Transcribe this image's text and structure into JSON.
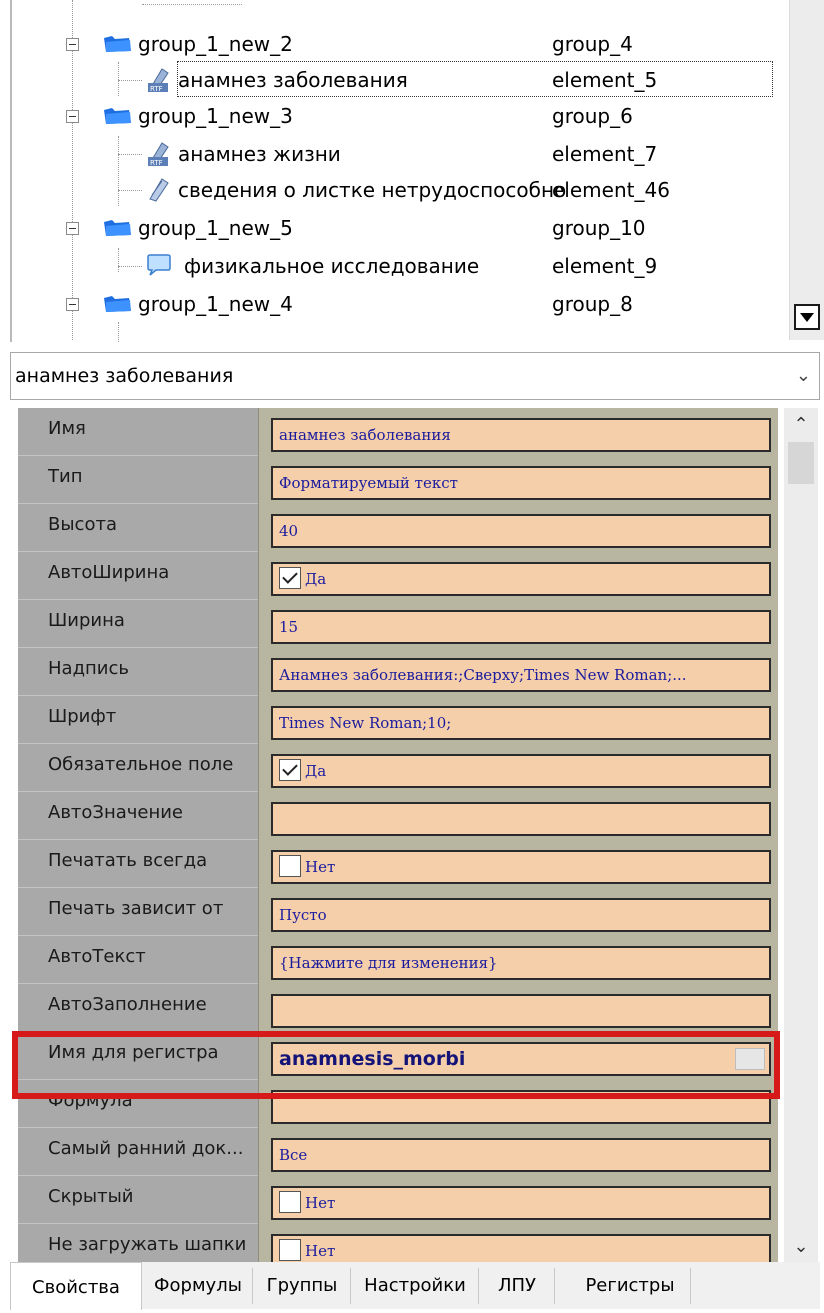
{
  "tree": {
    "rows": [
      {
        "name": "group_1_new_2",
        "id": "group_4",
        "kind": "group"
      },
      {
        "name": "анамнез заболевания",
        "id": "element_5",
        "kind": "rtf",
        "selected": true
      },
      {
        "name": "group_1_new_3",
        "id": "group_6",
        "kind": "group"
      },
      {
        "name": "анамнез жизни",
        "id": "element_7",
        "kind": "rtf"
      },
      {
        "name": "сведения о листке нетрудоспособно",
        "id": "element_46",
        "kind": "text"
      },
      {
        "name": "group_1_new_5",
        "id": "group_10",
        "kind": "group"
      },
      {
        "name": "физикальное исследование",
        "id": "element_9",
        "kind": "comment"
      },
      {
        "name": "group_1_new_4",
        "id": "group_8",
        "kind": "group"
      }
    ],
    "icons": {
      "group": "folder-icon",
      "rtf": "rtf-document-icon",
      "text": "document-icon",
      "comment": "speech-bubble-icon"
    }
  },
  "combo": {
    "value": "анамнез заболевания",
    "arrow": "chevron-down-icon"
  },
  "properties": [
    {
      "name": "Имя",
      "value": "анамнез заболевания"
    },
    {
      "name": "Тип",
      "value": "Форматируемый текст"
    },
    {
      "name": "Высота",
      "value": "40"
    },
    {
      "name": "АвтоШирина",
      "value": "Да",
      "checkbox": true,
      "checked": true
    },
    {
      "name": "Ширина",
      "value": "15"
    },
    {
      "name": "Надпись",
      "value": "Анамнез заболевания:;Сверху;Times New Roman;...",
      "expandable": true
    },
    {
      "name": "Шрифт",
      "value": "Times New Roman;10;",
      "expandable": true
    },
    {
      "name": "Обязательное поле",
      "value": "Да",
      "checkbox": true,
      "checked": true
    },
    {
      "name": "АвтоЗначение",
      "value": ""
    },
    {
      "name": "Печатать всегда",
      "value": "Нет",
      "checkbox": true,
      "checked": false
    },
    {
      "name": "Печать зависит от",
      "value": "Пусто"
    },
    {
      "name": "АвтоТекст",
      "value": "{Нажмите для изменения}"
    },
    {
      "name": "АвтоЗаполнение",
      "value": ""
    },
    {
      "name": "Имя для регистра",
      "value": "anamnesis_morbi",
      "bold": true,
      "highlighted": true
    },
    {
      "name": "Формула",
      "value": ""
    },
    {
      "name": "Самый ранний док...",
      "value": "Все"
    },
    {
      "name": "Скрытый",
      "value": "Нет",
      "checkbox": true,
      "checked": false
    },
    {
      "name": "Не загружать шапки",
      "value": "Нет",
      "checkbox": true,
      "checked": false
    }
  ],
  "tabs": [
    {
      "label": "Свойства",
      "active": true
    },
    {
      "label": "Формулы"
    },
    {
      "label": "Группы"
    },
    {
      "label": "Настройки"
    },
    {
      "label": "ЛПУ"
    },
    {
      "label": "Регистры"
    }
  ],
  "colors": {
    "value_bg": "#f5ceaa",
    "value_text": "#1b1b9e",
    "name_bg": "#a9a9a9",
    "highlight": "#d61a1a"
  }
}
